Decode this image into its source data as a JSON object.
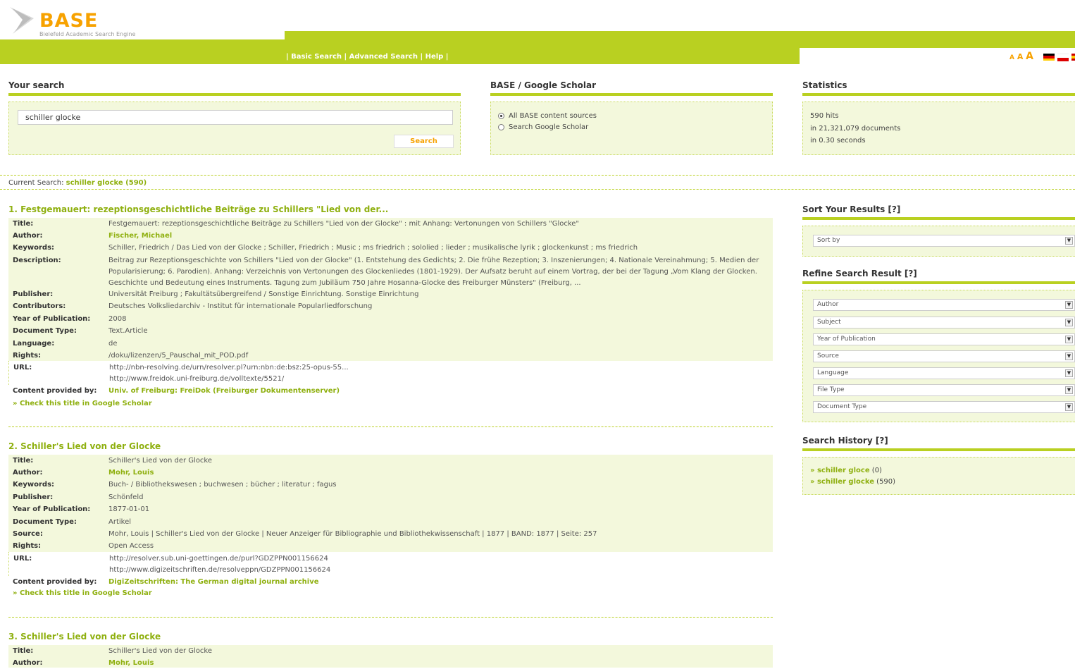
{
  "logo": {
    "word": "BASE",
    "subtitle": "Bielefeld Academic Search Engine"
  },
  "nav": {
    "text": "| Basic Search | Advanced Search | Help |"
  },
  "font_sizes": [
    "A",
    "A",
    "A"
  ],
  "your_search": {
    "title": "Your search",
    "query": "schiller glocke",
    "button": "Search"
  },
  "scholar": {
    "title": "BASE / Google Scholar",
    "options": [
      "All BASE content sources",
      "Search Google Scholar"
    ],
    "selected_index": 0
  },
  "statistics": {
    "title": "Statistics",
    "lines": [
      "590 hits",
      "in 21,321,079 documents",
      "in 0.30 seconds"
    ]
  },
  "current_search": {
    "label": "Current Search:",
    "value": "schiller glocke (590)"
  },
  "results": [
    {
      "heading": "1. Festgemauert: rezeptionsgeschichtliche Beiträge zu Schillers \"Lied von der...",
      "fields": [
        {
          "label": "Title:",
          "value": "Festgemauert: rezeptionsgeschichtliche Beiträge zu Schillers \"Lied von der Glocke\" : mit Anhang: Vertonungen von Schillers \"Glocke\""
        },
        {
          "label": "Author:",
          "value": "Fischer, Michael"
        },
        {
          "label": "Keywords:",
          "value": "Schiller, Friedrich / Das Lied von der Glocke ; Schiller, Friedrich ; Music ; ms friedrich ; sololied ; lieder ; musikalische lyrik ; glockenkunst ; ms friedrich"
        },
        {
          "label": "Description:",
          "value": "Beitrag zur Rezeptionsgeschichte von Schillers \"Lied von der Glocke\" (1. Entstehung des Gedichts; 2. Die frühe Rezeption; 3. Inszenierungen; 4. Nationale Vereinahmung; 5. Medien der Popularisierung; 6. Parodien). Anhang: Verzeichnis von Vertonungen des Glockenliedes (1801-1929). Der Aufsatz beruht auf einem Vortrag, der bei der Tagung „Vom Klang der Glocken. Geschichte und Bedeutung eines Instruments. Tagung zum Jubiläum 750 Jahre Hosanna-Glocke des Freiburger Münsters\" (Freiburg, ..."
        },
        {
          "label": "Publisher:",
          "value": "Universität Freiburg ; Fakultätsübergreifend / Sonstige Einrichtung. Sonstige Einrichtung"
        },
        {
          "label": "Contributors:",
          "value": "Deutsches Volksliedarchiv - Institut für internationale Popularliedforschung"
        },
        {
          "label": "Year of Publication:",
          "value": "2008"
        },
        {
          "label": "Document Type:",
          "value": "Text.Article"
        },
        {
          "label": "Language:",
          "value": "de"
        },
        {
          "label": "Rights:",
          "value": "/doku/lizenzen/5_Pauschal_mit_POD.pdf"
        }
      ],
      "url_label": "URL:",
      "urls": [
        "http://nbn-resolving.de/urn/resolver.pl?urn:nbn:de:bsz:25-opus-55...",
        "http://www.freidok.uni-freiburg.de/volltexte/5521/"
      ],
      "provider_label": "Content provided by:",
      "provider": "Univ. of Freiburg: FreiDok (Freiburger Dokumentenserver)",
      "scholar_link": "» Check this title in Google Scholar"
    },
    {
      "heading": "2. Schiller's Lied von der Glocke",
      "fields": [
        {
          "label": "Title:",
          "value": "Schiller's Lied von der Glocke"
        },
        {
          "label": "Author:",
          "value": "Mohr, Louis"
        },
        {
          "label": "Keywords:",
          "value": "Buch- / Bibliothekswesen ; buchwesen ; bücher ; literatur ; fagus"
        },
        {
          "label": "Publisher:",
          "value": "Schönfeld"
        },
        {
          "label": "Year of Publication:",
          "value": "1877-01-01"
        },
        {
          "label": "Document Type:",
          "value": "Artikel"
        },
        {
          "label": "Source:",
          "value": "Mohr, Louis | Schiller's Lied von der Glocke | Neuer Anzeiger für Bibliographie und Bibliothekwissenschaft | 1877 | BAND: 1877 | Seite: 257"
        },
        {
          "label": "Rights:",
          "value": "Open Access"
        }
      ],
      "url_label": "URL:",
      "urls": [
        "http://resolver.sub.uni-goettingen.de/purl?GDZPPN001156624",
        "http://www.digizeitschriften.de/resolveppn/GDZPPN001156624"
      ],
      "provider_label": "Content provided by:",
      "provider": "DigiZeitschriften: The German digital journal archive",
      "scholar_link": "» Check this title in Google Scholar"
    },
    {
      "heading": "3. Schiller's Lied von der Glocke",
      "fields": [
        {
          "label": "Title:",
          "value": "Schiller's Lied von der Glocke"
        },
        {
          "label": "Author:",
          "value": "Mohr, Louis"
        }
      ]
    }
  ],
  "sort": {
    "title": "Sort Your Results [?]",
    "select": "Sort by"
  },
  "refine": {
    "title": "Refine Search Result [?]",
    "selects": [
      "Author",
      "Subject",
      "Year of Publication",
      "Source",
      "Language",
      "File Type",
      "Document Type"
    ]
  },
  "history": {
    "title": "Search History [?]",
    "items": [
      {
        "query": "schiller gloce",
        "count": "(0)"
      },
      {
        "query": "schiller glocke",
        "count": "(590)"
      }
    ]
  },
  "colors": {
    "accent_green": "#b9d021",
    "link_green": "#8fb010",
    "orange": "#f7a200",
    "panel_bg": "#f3f8dc"
  }
}
